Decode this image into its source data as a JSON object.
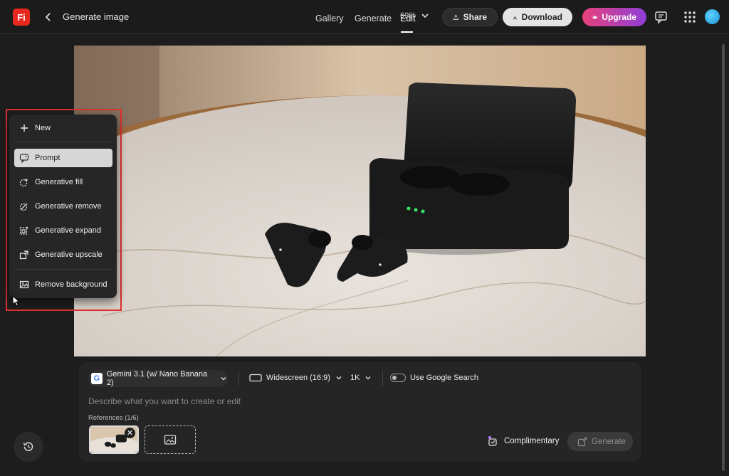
{
  "header": {
    "logo_text": "Fi",
    "page_title": "Generate image",
    "nav": [
      "Gallery",
      "Generate",
      "Edit"
    ],
    "zoom": "69%",
    "share_label": "Share",
    "download_label": "Download",
    "upgrade_label": "Upgrade",
    "accent_upgrade": "#d33f9e"
  },
  "menu": {
    "items": [
      {
        "label": "New",
        "icon": "plus-icon"
      },
      {
        "label": "Prompt",
        "icon": "prompt-icon",
        "active": true
      },
      {
        "label": "Generative fill",
        "icon": "generative-fill-icon"
      },
      {
        "label": "Generative remove",
        "icon": "generative-remove-icon"
      },
      {
        "label": "Generative expand",
        "icon": "generative-expand-icon"
      },
      {
        "label": "Generative upscale",
        "icon": "generative-upscale-icon"
      },
      {
        "label": "Remove background",
        "icon": "remove-background-icon"
      }
    ],
    "highlight_color": "#e03030"
  },
  "panel": {
    "model": "Gemini 3.1 (w/ Nano Banana 2)",
    "aspect": "Widescreen (16:9)",
    "resolution": "1K",
    "google_search_label": "Use Google Search",
    "prompt_placeholder": "Describe what you want to create or edit",
    "references_label": "References (1/6)",
    "credits_label": "Complimentary",
    "generate_label": "Generate"
  }
}
